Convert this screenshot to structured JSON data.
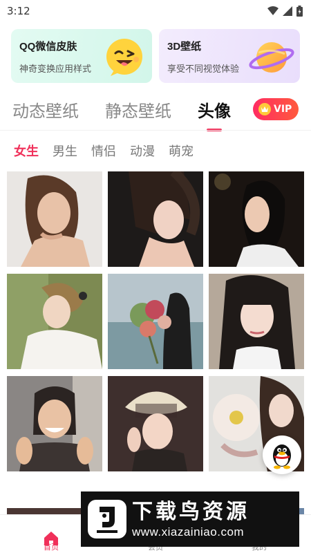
{
  "status_bar": {
    "time": "3:12",
    "icons": [
      "wifi-icon",
      "signal-icon",
      "battery-icon"
    ]
  },
  "promos": [
    {
      "title": "QQ微信皮肤",
      "subtitle": "神奇变换应用样式",
      "icon": "winking-emoji-icon"
    },
    {
      "title": "3D壁纸",
      "subtitle": "享受不同视觉体验",
      "icon": "planet-icon"
    }
  ],
  "main_tabs": [
    {
      "label": "动态壁纸",
      "active": false
    },
    {
      "label": "静态壁纸",
      "active": false
    },
    {
      "label": "头像",
      "active": true
    }
  ],
  "vip": {
    "label": "VIP",
    "icon": "crown-icon"
  },
  "sub_tabs": [
    {
      "label": "女生",
      "active": true
    },
    {
      "label": "男生",
      "active": false
    },
    {
      "label": "情侣",
      "active": false
    },
    {
      "label": "动漫",
      "active": false
    },
    {
      "label": "萌宠",
      "active": false
    }
  ],
  "grid_images": [
    "avatar-photo-1",
    "avatar-photo-2",
    "avatar-photo-3",
    "avatar-photo-4",
    "avatar-photo-5",
    "avatar-photo-6",
    "avatar-photo-7",
    "avatar-photo-8",
    "avatar-photo-9",
    "avatar-photo-10",
    "avatar-photo-11",
    "avatar-photo-12"
  ],
  "bottom_nav": [
    {
      "label": "首页",
      "icon": "home-icon",
      "active": true
    },
    {
      "label": "会员",
      "icon": "member-icon",
      "active": false
    },
    {
      "label": "我的",
      "icon": "profile-icon",
      "active": false
    }
  ],
  "watermark": {
    "title": "下载鸟资源",
    "url": "www.xiazainiao.com"
  },
  "colors": {
    "accent": "#f0305a",
    "vip_gradient_start": "#ff2c62",
    "vip_gradient_end": "#ff5a3d"
  }
}
